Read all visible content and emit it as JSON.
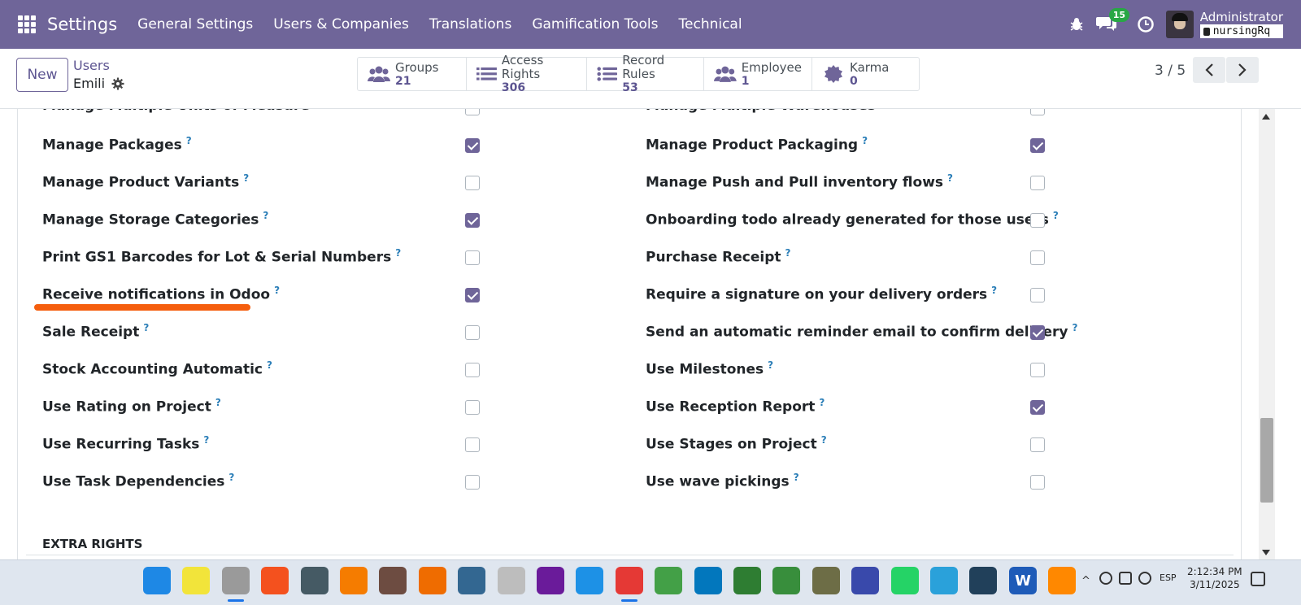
{
  "navbar": {
    "brand": "Settings",
    "menu": [
      "General Settings",
      "Users & Companies",
      "Translations",
      "Gamification Tools",
      "Technical"
    ],
    "chat_badge": "15",
    "user_name": "Administrator",
    "db_name": "nursingRq"
  },
  "control": {
    "new_label": "New",
    "breadcrumb_parent": "Users",
    "breadcrumb_current": "Emili",
    "stats": [
      {
        "label": "Groups",
        "value": "21",
        "icon": "users-icon"
      },
      {
        "label": "Access Rights",
        "value": "306",
        "icon": "list-icon"
      },
      {
        "label": "Record Rules",
        "value": "53",
        "icon": "list-icon"
      },
      {
        "label": "Employee",
        "value": "1",
        "icon": "users-icon"
      },
      {
        "label": "Karma",
        "value": "0",
        "icon": "badge-icon"
      }
    ],
    "pager": "3 / 5"
  },
  "fields_left": [
    {
      "label": "Manage Multiple Units of Measure",
      "checked": false,
      "help": false
    },
    {
      "label": "Manage Packages",
      "checked": true,
      "help": true
    },
    {
      "label": "Manage Product Variants",
      "checked": false,
      "help": true
    },
    {
      "label": "Manage Storage Categories",
      "checked": true,
      "help": true
    },
    {
      "label": "Print GS1 Barcodes for Lot & Serial Numbers",
      "checked": false,
      "help": true
    },
    {
      "label": "Receive notifications in Odoo",
      "checked": true,
      "help": true
    },
    {
      "label": "Sale Receipt",
      "checked": false,
      "help": true
    },
    {
      "label": "Stock Accounting Automatic",
      "checked": false,
      "help": true
    },
    {
      "label": "Use Rating on Project",
      "checked": false,
      "help": true
    },
    {
      "label": "Use Recurring Tasks",
      "checked": false,
      "help": true
    },
    {
      "label": "Use Task Dependencies",
      "checked": false,
      "help": true
    }
  ],
  "fields_right": [
    {
      "label": "Manage Multiple Warehouses",
      "checked": false,
      "help": false
    },
    {
      "label": "Manage Product Packaging",
      "checked": true,
      "help": true
    },
    {
      "label": "Manage Push and Pull inventory flows",
      "checked": false,
      "help": true
    },
    {
      "label": "Onboarding todo already generated for those users",
      "checked": false,
      "help": true
    },
    {
      "label": "Purchase Receipt",
      "checked": false,
      "help": true
    },
    {
      "label": "Require a signature on your delivery orders",
      "checked": false,
      "help": true
    },
    {
      "label": "Send an automatic reminder email to confirm delivery",
      "checked": true,
      "help": true
    },
    {
      "label": "Use Milestones",
      "checked": false,
      "help": true
    },
    {
      "label": "Use Reception Report",
      "checked": true,
      "help": true
    },
    {
      "label": "Use Stages on Project",
      "checked": false,
      "help": true
    },
    {
      "label": "Use wave pickings",
      "checked": false,
      "help": true
    }
  ],
  "help_mark": "?",
  "section_title": "EXTRA RIGHTS",
  "taskbar": {
    "apps": [
      {
        "name": "windows-start-icon",
        "color": "#1e88e5",
        "glyph": "",
        "active": false
      },
      {
        "name": "sticky-notes-icon",
        "color": "#f2e43a",
        "glyph": "",
        "active": false
      },
      {
        "name": "file-explorer-icon",
        "color": "#9a9a9a",
        "glyph": "",
        "active": true
      },
      {
        "name": "flame-app-icon",
        "color": "#f4511e",
        "glyph": "",
        "active": false
      },
      {
        "name": "network-app-icon",
        "color": "#455a64",
        "glyph": "",
        "active": false
      },
      {
        "name": "search-app-icon",
        "color": "#f57c00",
        "glyph": "",
        "active": false
      },
      {
        "name": "gimp-icon",
        "color": "#6d4c41",
        "glyph": "",
        "active": false
      },
      {
        "name": "blender-icon",
        "color": "#ef6c00",
        "glyph": "",
        "active": false
      },
      {
        "name": "postgresql-icon",
        "color": "#336791",
        "glyph": "",
        "active": false
      },
      {
        "name": "search-tool-icon",
        "color": "#bdbdbd",
        "glyph": "",
        "active": false
      },
      {
        "name": "github-icon",
        "color": "#6a1b9a",
        "glyph": "",
        "active": false
      },
      {
        "name": "docker-icon",
        "color": "#1d91e6",
        "glyph": "",
        "active": false
      },
      {
        "name": "chrome-icon",
        "color": "#e53935",
        "glyph": "",
        "active": true
      },
      {
        "name": "clock-app-icon",
        "color": "#43a047",
        "glyph": "",
        "active": false
      },
      {
        "name": "vscode-icon",
        "color": "#0277bd",
        "glyph": "",
        "active": false
      },
      {
        "name": "pipe-app-icon",
        "color": "#2e7d32",
        "glyph": "",
        "active": false
      },
      {
        "name": "gear-app-icon",
        "color": "#388e3c",
        "glyph": "",
        "active": false
      },
      {
        "name": "game-app-icon",
        "color": "#6d6d46",
        "glyph": "",
        "active": false
      },
      {
        "name": "grid-app-icon",
        "color": "#3949ab",
        "glyph": "",
        "active": false
      },
      {
        "name": "whatsapp-icon",
        "color": "#25d366",
        "glyph": "",
        "active": false
      },
      {
        "name": "telegram-icon",
        "color": "#2aa1da",
        "glyph": "",
        "active": false
      },
      {
        "name": "wordpress-app-icon",
        "color": "#21405a",
        "glyph": "",
        "active": false
      },
      {
        "name": "word-icon",
        "color": "#1e5bb8",
        "glyph": "W",
        "active": false
      },
      {
        "name": "vlc-icon",
        "color": "#ff8800",
        "glyph": "",
        "active": false
      }
    ],
    "language": "ESP",
    "time": "2:12:34 PM",
    "date": "3/11/2025"
  }
}
